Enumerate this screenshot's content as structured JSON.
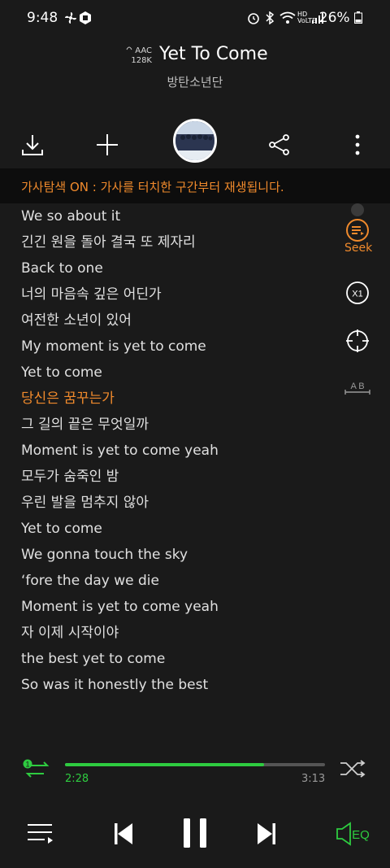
{
  "status": {
    "time": "9:48",
    "battery": "26%"
  },
  "header": {
    "quality_line1": "AAC",
    "quality_line2": "128K",
    "title": "Yet To Come",
    "artist": "방탄소년단"
  },
  "notice": "가사탐색 ON : 가사를 터치한 구간부터 재생됩니다.",
  "side_tools": {
    "seek_label": "Seek",
    "speed_label": "X1",
    "ab_label": "A B"
  },
  "lyrics": [
    {
      "text": "We so about it",
      "active": false
    },
    {
      "text": "긴긴 원을 돌아 결국 또 제자리",
      "active": false
    },
    {
      "text": "Back to one",
      "active": false
    },
    {
      "text": "너의 마음속 깊은 어딘가",
      "active": false
    },
    {
      "text": "여전한 소년이 있어",
      "active": false
    },
    {
      "text": "My moment is yet to come",
      "active": false
    },
    {
      "text": "Yet to come",
      "active": false
    },
    {
      "text": "당신은 꿈꾸는가",
      "active": true
    },
    {
      "text": "그 길의 끝은 무엇일까",
      "active": false
    },
    {
      "text": "Moment is yet to come yeah",
      "active": false
    },
    {
      "text": "모두가 숨죽인 밤",
      "active": false
    },
    {
      "text": "우린 발을 멈추지 않아",
      "active": false
    },
    {
      "text": "Yet to come",
      "active": false
    },
    {
      "text": "We gonna touch the sky",
      "active": false
    },
    {
      "text": "‘fore the day we die",
      "active": false
    },
    {
      "text": "Moment is yet to come yeah",
      "active": false
    },
    {
      "text": "자 이제 시작이야",
      "active": false
    },
    {
      "text": "the best yet to come",
      "active": false
    },
    {
      "text": "So was it honestly the best",
      "active": false
    }
  ],
  "player": {
    "current_time": "2:28",
    "total_time": "3:13",
    "progress": 0.766,
    "repeat_badge": "1",
    "eq_label": "EQ"
  },
  "colors": {
    "accent": "#f08a2c",
    "progress": "#2ecc40",
    "background": "#1a1a1a"
  }
}
